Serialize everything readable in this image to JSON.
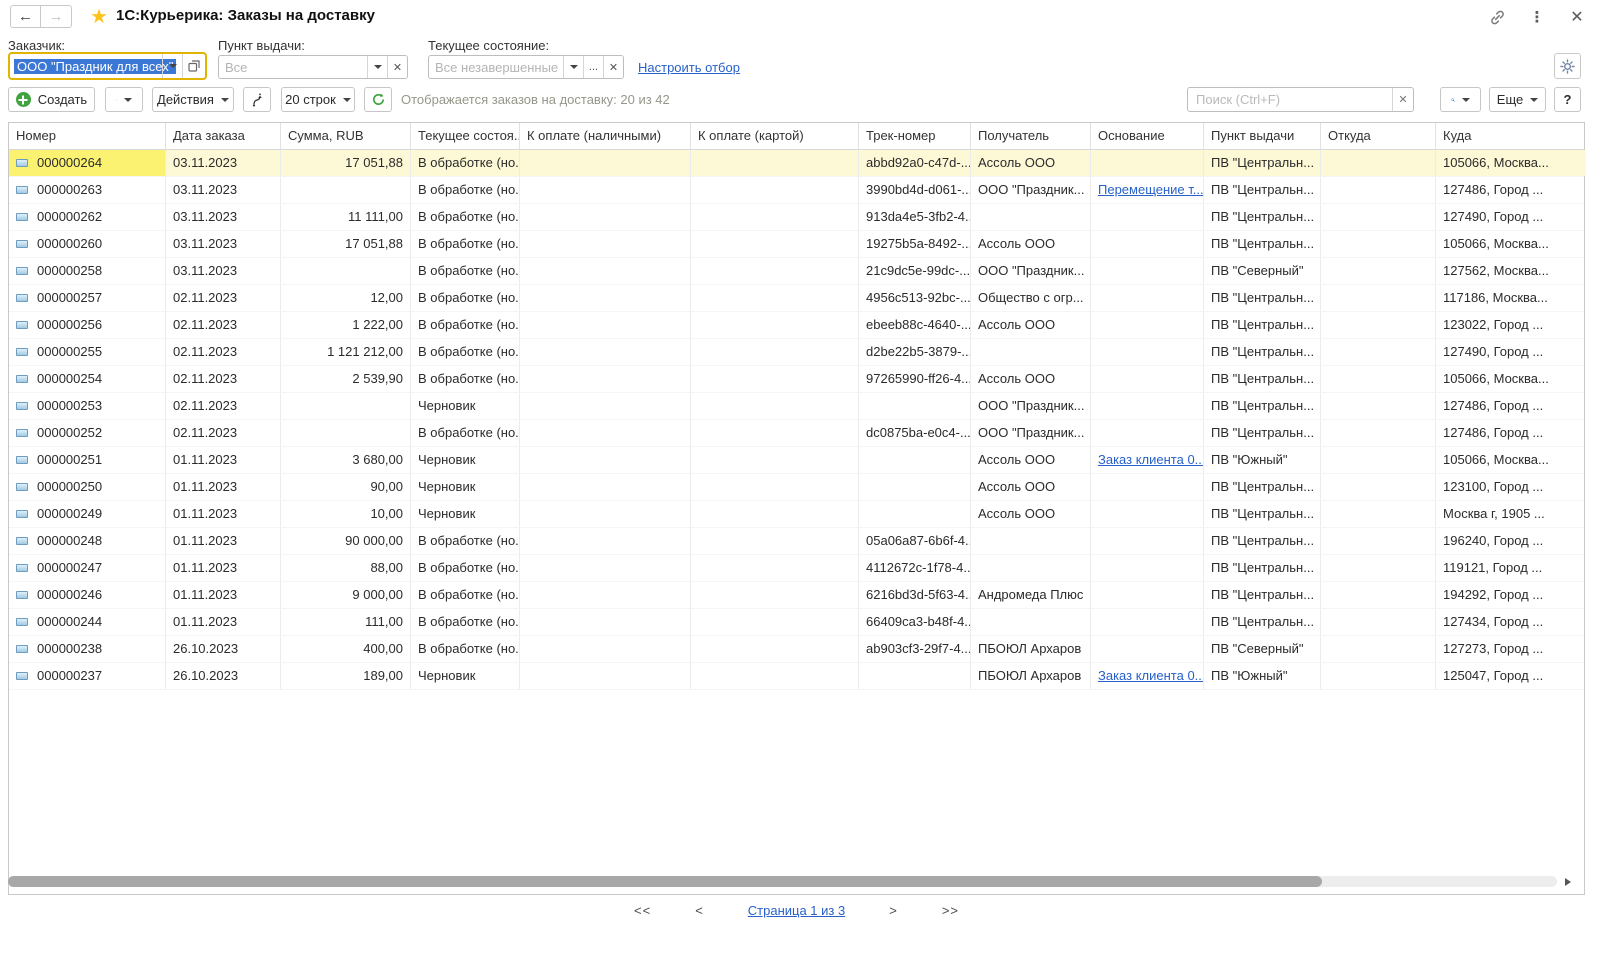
{
  "window": {
    "title": "1С:Курьерика: Заказы на доставку"
  },
  "filters": {
    "customer": {
      "label": "Заказчик:",
      "value": "ООО \"Праздник для всех\""
    },
    "pickup_point": {
      "label": "Пункт выдачи:",
      "placeholder": "Все"
    },
    "current_state": {
      "label": "Текущее состояние:",
      "placeholder": "Все незавершенные",
      "ellipsis_button": "..."
    },
    "configure_filter_link": "Настроить отбор"
  },
  "toolbar": {
    "create_label": "Создать",
    "actions_label": "Действия",
    "rows_label": "20 строк",
    "status_text": "Отображается заказов на доставку: 20 из 42",
    "search_placeholder": "Поиск (Ctrl+F)",
    "more_label": "Еще",
    "help_label": "?"
  },
  "icons": {
    "back": "back-arrow-icon",
    "forward": "forward-arrow-icon",
    "favorite": "star-icon",
    "get_link": "chain-link-icon",
    "menu": "kebab-menu-icon",
    "close": "close-icon",
    "settings": "gear-icon",
    "create": "plus-circle-icon",
    "print": "document-chart-icon",
    "reorder": "swap-arrows-icon",
    "refresh": "refresh-icon",
    "search": "magnifier-icon",
    "row_marker": "document-icon"
  },
  "colors": {
    "selection_row": "#fdf8d6",
    "selection_cell": "#fbf271",
    "focus_border": "#e0b400",
    "link_blue": "#2861c9",
    "accent_green": "#3fa43f",
    "star_yellow": "#ffc31e",
    "text_selection_bg": "#3b77d4"
  },
  "table": {
    "columns": [
      "Номер",
      "Дата заказа",
      "Сумма, RUB",
      "Текущее состоя...",
      "К оплате (наличными)",
      "К оплате (картой)",
      "Трек-номер",
      "Получатель",
      "Основание",
      "Пункт выдачи",
      "Откуда",
      "Куда"
    ],
    "rows": [
      {
        "selected": true,
        "number": "000000264",
        "date": "03.11.2023",
        "sum": "17 051,88",
        "state": "В обработке (но...",
        "cash": "",
        "card": "",
        "track": "abbd92a0-c47d-...",
        "recipient": "Ассоль ООО",
        "basis": "",
        "basis_link": false,
        "pickup": "ПВ \"Центральн...",
        "from": "",
        "to": "105066, Москва..."
      },
      {
        "number": "000000263",
        "date": "03.11.2023",
        "sum": "",
        "state": "В обработке (но...",
        "cash": "",
        "card": "",
        "track": "3990bd4d-d061-...",
        "recipient": "ООО \"Праздник...",
        "basis": "Перемещение т...",
        "basis_link": true,
        "pickup": "ПВ \"Центральн...",
        "from": "",
        "to": "127486, Город ..."
      },
      {
        "number": "000000262",
        "date": "03.11.2023",
        "sum": "11 111,00",
        "state": "В обработке (но...",
        "cash": "",
        "card": "",
        "track": "913da4e5-3fb2-4...",
        "recipient": "",
        "basis": "",
        "basis_link": false,
        "pickup": "ПВ \"Центральн...",
        "from": "",
        "to": "127490, Город ..."
      },
      {
        "number": "000000260",
        "date": "03.11.2023",
        "sum": "17 051,88",
        "state": "В обработке (но...",
        "cash": "",
        "card": "",
        "track": "19275b5a-8492-...",
        "recipient": "Ассоль ООО",
        "basis": "",
        "basis_link": false,
        "pickup": "ПВ \"Центральн...",
        "from": "",
        "to": "105066, Москва..."
      },
      {
        "number": "000000258",
        "date": "03.11.2023",
        "sum": "",
        "state": "В обработке (но...",
        "cash": "",
        "card": "",
        "track": "21c9dc5e-99dc-...",
        "recipient": "ООО \"Праздник...",
        "basis": "",
        "basis_link": false,
        "pickup": "ПВ \"Северный\"",
        "from": "",
        "to": "127562, Москва..."
      },
      {
        "number": "000000257",
        "date": "02.11.2023",
        "sum": "12,00",
        "state": "В обработке (но...",
        "cash": "",
        "card": "",
        "track": "4956c513-92bc-...",
        "recipient": "Общество с огр...",
        "basis": "",
        "basis_link": false,
        "pickup": "ПВ \"Центральн...",
        "from": "",
        "to": "117186, Москва..."
      },
      {
        "number": "000000256",
        "date": "02.11.2023",
        "sum": "1 222,00",
        "state": "В обработке (но...",
        "cash": "",
        "card": "",
        "track": "ebeeb88c-4640-...",
        "recipient": "Ассоль ООО",
        "basis": "",
        "basis_link": false,
        "pickup": "ПВ \"Центральн...",
        "from": "",
        "to": "123022, Город ..."
      },
      {
        "number": "000000255",
        "date": "02.11.2023",
        "sum": "1 121 212,00",
        "state": "В обработке (но...",
        "cash": "",
        "card": "",
        "track": "d2be22b5-3879-...",
        "recipient": "",
        "basis": "",
        "basis_link": false,
        "pickup": "ПВ \"Центральн...",
        "from": "",
        "to": "127490, Город ..."
      },
      {
        "number": "000000254",
        "date": "02.11.2023",
        "sum": "2 539,90",
        "state": "В обработке (но...",
        "cash": "",
        "card": "",
        "track": "97265990-ff26-4...",
        "recipient": "Ассоль ООО",
        "basis": "",
        "basis_link": false,
        "pickup": "ПВ \"Центральн...",
        "from": "",
        "to": "105066, Москва..."
      },
      {
        "number": "000000253",
        "date": "02.11.2023",
        "sum": "",
        "state": "Черновик",
        "cash": "",
        "card": "",
        "track": "",
        "recipient": "ООО \"Праздник...",
        "basis": "",
        "basis_link": false,
        "pickup": "ПВ \"Центральн...",
        "from": "",
        "to": "127486, Город ..."
      },
      {
        "number": "000000252",
        "date": "02.11.2023",
        "sum": "",
        "state": "В обработке (но...",
        "cash": "",
        "card": "",
        "track": "dc0875ba-e0c4-...",
        "recipient": "ООО \"Праздник...",
        "basis": "",
        "basis_link": false,
        "pickup": "ПВ \"Центральн...",
        "from": "",
        "to": "127486, Город ..."
      },
      {
        "number": "000000251",
        "date": "01.11.2023",
        "sum": "3 680,00",
        "state": "Черновик",
        "cash": "",
        "card": "",
        "track": "",
        "recipient": "Ассоль ООО",
        "basis": "Заказ клиента 0...",
        "basis_link": true,
        "pickup": "ПВ \"Южный\"",
        "from": "",
        "to": "105066, Москва..."
      },
      {
        "number": "000000250",
        "date": "01.11.2023",
        "sum": "90,00",
        "state": "Черновик",
        "cash": "",
        "card": "",
        "track": "",
        "recipient": "Ассоль ООО",
        "basis": "",
        "basis_link": false,
        "pickup": "ПВ \"Центральн...",
        "from": "",
        "to": "123100, Город ..."
      },
      {
        "number": "000000249",
        "date": "01.11.2023",
        "sum": "10,00",
        "state": "Черновик",
        "cash": "",
        "card": "",
        "track": "",
        "recipient": "Ассоль ООО",
        "basis": "",
        "basis_link": false,
        "pickup": "ПВ \"Центральн...",
        "from": "",
        "to": "Москва г, 1905 ..."
      },
      {
        "number": "000000248",
        "date": "01.11.2023",
        "sum": "90 000,00",
        "state": "В обработке (но...",
        "cash": "",
        "card": "",
        "track": "05a06a87-6b6f-4...",
        "recipient": "",
        "basis": "",
        "basis_link": false,
        "pickup": "ПВ \"Центральн...",
        "from": "",
        "to": "196240, Город ..."
      },
      {
        "number": "000000247",
        "date": "01.11.2023",
        "sum": "88,00",
        "state": "В обработке (но...",
        "cash": "",
        "card": "",
        "track": "4112672c-1f78-4...",
        "recipient": "",
        "basis": "",
        "basis_link": false,
        "pickup": "ПВ \"Центральн...",
        "from": "",
        "to": "119121, Город ..."
      },
      {
        "number": "000000246",
        "date": "01.11.2023",
        "sum": "9 000,00",
        "state": "В обработке (но...",
        "cash": "",
        "card": "",
        "track": "6216bd3d-5f63-4...",
        "recipient": "Андромеда Плюс",
        "basis": "",
        "basis_link": false,
        "pickup": "ПВ \"Центральн...",
        "from": "",
        "to": "194292, Город ..."
      },
      {
        "number": "000000244",
        "date": "01.11.2023",
        "sum": "111,00",
        "state": "В обработке (но...",
        "cash": "",
        "card": "",
        "track": "66409ca3-b48f-4...",
        "recipient": "",
        "basis": "",
        "basis_link": false,
        "pickup": "ПВ \"Центральн...",
        "from": "",
        "to": "127434, Город ..."
      },
      {
        "number": "000000238",
        "date": "26.10.2023",
        "sum": "400,00",
        "state": "В обработке (но...",
        "cash": "",
        "card": "",
        "track": "ab903cf3-29f7-4...",
        "recipient": "ПБОЮЛ Архаров",
        "basis": "",
        "basis_link": false,
        "pickup": "ПВ \"Северный\"",
        "from": "",
        "to": "127273, Город ..."
      },
      {
        "number": "000000237",
        "date": "26.10.2023",
        "sum": "189,00",
        "state": "Черновик",
        "cash": "",
        "card": "",
        "track": "",
        "recipient": "ПБОЮЛ Архаров",
        "basis": "Заказ клиента 0...",
        "basis_link": true,
        "pickup": "ПВ \"Южный\"",
        "from": "",
        "to": "125047, Город ..."
      }
    ]
  },
  "pagination": {
    "first": "<<",
    "prev": "<",
    "page_label": "Страница 1 из 3",
    "next": ">",
    "last": ">>"
  }
}
